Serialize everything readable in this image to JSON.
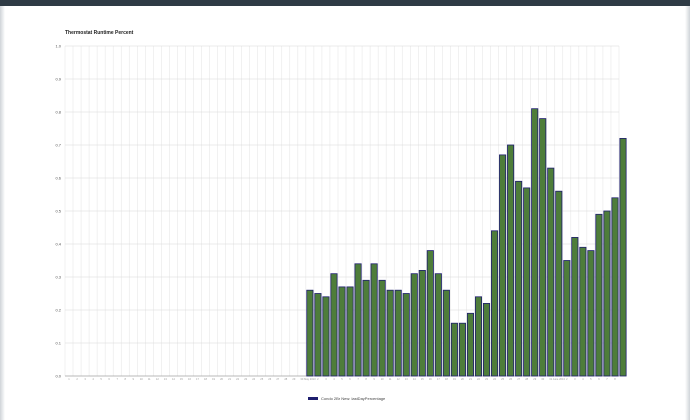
{
  "chart_data": {
    "type": "bar",
    "title": "Thermostat Runtime Percent",
    "xlabel": "",
    "ylabel": "",
    "ylim": [
      0,
      1.0
    ],
    "yticks": [
      "0.0",
      "0.1",
      "0.2",
      "0.3",
      "0.4",
      "0.5",
      "0.6",
      "0.7",
      "0.8",
      "0.9",
      "1.0"
    ],
    "grid": true,
    "legend_position": "bottom-center",
    "colors": {
      "bar_fill": "#4e7d3a",
      "bar_stroke": "#1e1e6e",
      "grid": "#e3e3e3",
      "axis_text": "#555555"
    },
    "categories": [
      "1",
      "2",
      "3",
      "4",
      "5",
      "6",
      "7",
      "8",
      "9",
      "10",
      "11",
      "12",
      "13",
      "14",
      "15",
      "16",
      "17",
      "18",
      "19",
      "20",
      "21",
      "22",
      "23",
      "24",
      "25",
      "26",
      "27",
      "28",
      "29",
      "30",
      "May 2013",
      "2",
      "3",
      "4",
      "5",
      "6",
      "7",
      "8",
      "9",
      "10",
      "11",
      "12",
      "13",
      "14",
      "15",
      "16",
      "17",
      "18",
      "19",
      "20",
      "21",
      "22",
      "23",
      "24",
      "25",
      "26",
      "27",
      "28",
      "29",
      "30",
      "31",
      "June 2013",
      "2",
      "3",
      "4",
      "5",
      "6",
      "7",
      "8"
    ],
    "series": [
      {
        "name": "Condo 2Br New: lastDayPercentage",
        "values": [
          0,
          0,
          0,
          0,
          0,
          0,
          0,
          0,
          0,
          0,
          0,
          0,
          0,
          0,
          0,
          0,
          0,
          0,
          0,
          0,
          0,
          0,
          0,
          0,
          0,
          0,
          0,
          0,
          0,
          0,
          0.26,
          0.25,
          0.24,
          0.31,
          0.27,
          0.27,
          0.34,
          0.29,
          0.34,
          0.29,
          0.26,
          0.26,
          0.25,
          0.31,
          0.32,
          0.38,
          0.31,
          0.26,
          0.16,
          0.16,
          0.19,
          0.24,
          0.22,
          0.44,
          0.67,
          0.7,
          0.59,
          0.57,
          0.81,
          0.78,
          0.63,
          0.56,
          0.35,
          0.42,
          0.39,
          0.38,
          0.49,
          0.5,
          0.54,
          0.72
        ]
      }
    ]
  }
}
